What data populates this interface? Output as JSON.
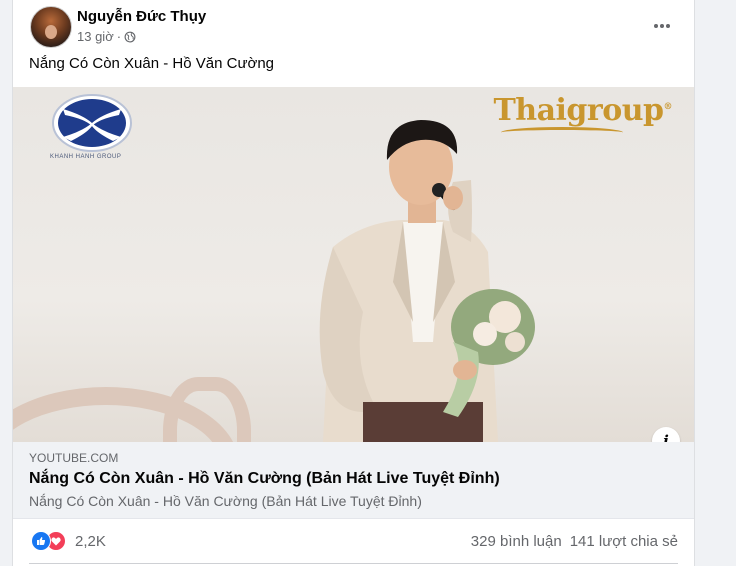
{
  "post": {
    "author": "Nguyễn Đức Thụy",
    "time": "13 giờ",
    "separator": "·",
    "caption": "Nắng Có Còn Xuân - Hồ Văn Cường",
    "privacy_icon": "globe-icon",
    "more_icon": "more-dots-icon"
  },
  "media": {
    "logo_left_caption": "KHANH HANH GROUP",
    "logo_right": "Thaigroup",
    "logo_right_mark": "®",
    "info_label": "i"
  },
  "link": {
    "domain": "YOUTUBE.COM",
    "title": "Nắng Có Còn Xuân - Hồ Văn Cường (Bản Hát Live Tuyệt Đỉnh)",
    "description": "Nắng Có Còn Xuân - Hồ Văn Cường (Bản Hát Live Tuyệt Đỉnh)"
  },
  "stats": {
    "reactions": "2,2K",
    "comments": "329 bình luận",
    "shares": "141 lượt chia sẻ",
    "reaction_icons": [
      "like-icon",
      "love-icon"
    ]
  },
  "colors": {
    "like": "#1877f2",
    "love": "#f33e58",
    "thaigroup_gold": "#c9962e",
    "logo_blue": "#1f3c8c"
  }
}
